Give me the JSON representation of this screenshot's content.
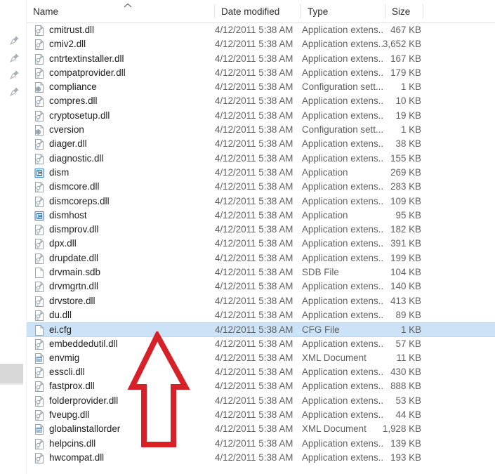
{
  "window": {
    "kind": "file-explorer-list-view"
  },
  "columns": {
    "name": "Name",
    "date_modified": "Date modified",
    "type": "Type",
    "size": "Size",
    "sort_indicator": "sort-ascending-arrow"
  },
  "annotation": {
    "shape": "up-arrow-outline",
    "color": "#d62128",
    "points_at": "ei.cfg"
  },
  "sidebar": {
    "pins": [
      {
        "icon": "pin-icon"
      },
      {
        "icon": "pin-icon"
      },
      {
        "icon": "pin-icon"
      },
      {
        "icon": "pin-icon"
      }
    ],
    "scroll_block": "scrollbar-thumb"
  },
  "files": [
    {
      "name": "cmitrust.dll",
      "date": "4/12/2011 5:38 AM",
      "type": "Application extens...",
      "size": "467 KB",
      "icon": "dll-icon",
      "selected": false
    },
    {
      "name": "cmiv2.dll",
      "date": "4/12/2011 5:38 AM",
      "type": "Application extens...",
      "size": "3,652 KB",
      "icon": "dll-icon",
      "selected": false
    },
    {
      "name": "cntrtextinstaller.dll",
      "date": "4/12/2011 5:38 AM",
      "type": "Application extens...",
      "size": "167 KB",
      "icon": "dll-icon",
      "selected": false
    },
    {
      "name": "compatprovider.dll",
      "date": "4/12/2011 5:38 AM",
      "type": "Application extens...",
      "size": "179 KB",
      "icon": "dll-icon",
      "selected": false
    },
    {
      "name": "compliance",
      "date": "4/12/2011 5:38 AM",
      "type": "Configuration sett...",
      "size": "1 KB",
      "icon": "config-icon",
      "selected": false
    },
    {
      "name": "compres.dll",
      "date": "4/12/2011 5:38 AM",
      "type": "Application extens...",
      "size": "10 KB",
      "icon": "dll-icon",
      "selected": false
    },
    {
      "name": "cryptosetup.dll",
      "date": "4/12/2011 5:38 AM",
      "type": "Application extens...",
      "size": "19 KB",
      "icon": "dll-icon",
      "selected": false
    },
    {
      "name": "cversion",
      "date": "4/12/2011 5:38 AM",
      "type": "Configuration sett...",
      "size": "1 KB",
      "icon": "config-icon",
      "selected": false
    },
    {
      "name": "diager.dll",
      "date": "4/12/2011 5:38 AM",
      "type": "Application extens...",
      "size": "38 KB",
      "icon": "dll-icon",
      "selected": false
    },
    {
      "name": "diagnostic.dll",
      "date": "4/12/2011 5:38 AM",
      "type": "Application extens...",
      "size": "155 KB",
      "icon": "dll-icon",
      "selected": false
    },
    {
      "name": "dism",
      "date": "4/12/2011 5:38 AM",
      "type": "Application",
      "size": "269 KB",
      "icon": "exe-icon",
      "selected": false
    },
    {
      "name": "dismcore.dll",
      "date": "4/12/2011 5:38 AM",
      "type": "Application extens...",
      "size": "283 KB",
      "icon": "dll-icon",
      "selected": false
    },
    {
      "name": "dismcoreps.dll",
      "date": "4/12/2011 5:38 AM",
      "type": "Application extens...",
      "size": "109 KB",
      "icon": "dll-icon",
      "selected": false
    },
    {
      "name": "dismhost",
      "date": "4/12/2011 5:38 AM",
      "type": "Application",
      "size": "95 KB",
      "icon": "exe-icon",
      "selected": false
    },
    {
      "name": "dismprov.dll",
      "date": "4/12/2011 5:38 AM",
      "type": "Application extens...",
      "size": "182 KB",
      "icon": "dll-icon",
      "selected": false
    },
    {
      "name": "dpx.dll",
      "date": "4/12/2011 5:38 AM",
      "type": "Application extens...",
      "size": "391 KB",
      "icon": "dll-icon",
      "selected": false
    },
    {
      "name": "drupdate.dll",
      "date": "4/12/2011 5:38 AM",
      "type": "Application extens...",
      "size": "199 KB",
      "icon": "dll-icon",
      "selected": false
    },
    {
      "name": "drvmain.sdb",
      "date": "4/12/2011 5:38 AM",
      "type": "SDB File",
      "size": "104 KB",
      "icon": "blank-icon",
      "selected": false
    },
    {
      "name": "drvmgrtn.dll",
      "date": "4/12/2011 5:38 AM",
      "type": "Application extens...",
      "size": "140 KB",
      "icon": "dll-icon",
      "selected": false
    },
    {
      "name": "drvstore.dll",
      "date": "4/12/2011 5:38 AM",
      "type": "Application extens...",
      "size": "413 KB",
      "icon": "dll-icon",
      "selected": false
    },
    {
      "name": "du.dll",
      "date": "4/12/2011 5:38 AM",
      "type": "Application extens...",
      "size": "89 KB",
      "icon": "dll-icon",
      "selected": false
    },
    {
      "name": "ei.cfg",
      "date": "4/12/2011 5:38 AM",
      "type": "CFG File",
      "size": "1 KB",
      "icon": "blank-icon",
      "selected": true
    },
    {
      "name": "embeddedutil.dll",
      "date": "4/12/2011 5:38 AM",
      "type": "Application extens...",
      "size": "57 KB",
      "icon": "dll-icon",
      "selected": false
    },
    {
      "name": "envmig",
      "date": "4/12/2011 5:38 AM",
      "type": "XML Document",
      "size": "11 KB",
      "icon": "xml-icon",
      "selected": false
    },
    {
      "name": "esscli.dll",
      "date": "4/12/2011 5:38 AM",
      "type": "Application extens...",
      "size": "430 KB",
      "icon": "dll-icon",
      "selected": false
    },
    {
      "name": "fastprox.dll",
      "date": "4/12/2011 5:38 AM",
      "type": "Application extens...",
      "size": "888 KB",
      "icon": "dll-icon",
      "selected": false
    },
    {
      "name": "folderprovider.dll",
      "date": "4/12/2011 5:38 AM",
      "type": "Application extens...",
      "size": "53 KB",
      "icon": "dll-icon",
      "selected": false
    },
    {
      "name": "fveupg.dll",
      "date": "4/12/2011 5:38 AM",
      "type": "Application extens...",
      "size": "44 KB",
      "icon": "dll-icon",
      "selected": false
    },
    {
      "name": "globalinstallorder",
      "date": "4/12/2011 5:38 AM",
      "type": "XML Document",
      "size": "1,928 KB",
      "icon": "xml-icon",
      "selected": false
    },
    {
      "name": "helpcins.dll",
      "date": "4/12/2011 5:38 AM",
      "type": "Application extens...",
      "size": "139 KB",
      "icon": "dll-icon",
      "selected": false
    },
    {
      "name": "hwcompat.dll",
      "date": "4/12/2011 5:38 AM",
      "type": "Application extens...",
      "size": "193 KB",
      "icon": "dll-icon",
      "selected": false
    }
  ]
}
